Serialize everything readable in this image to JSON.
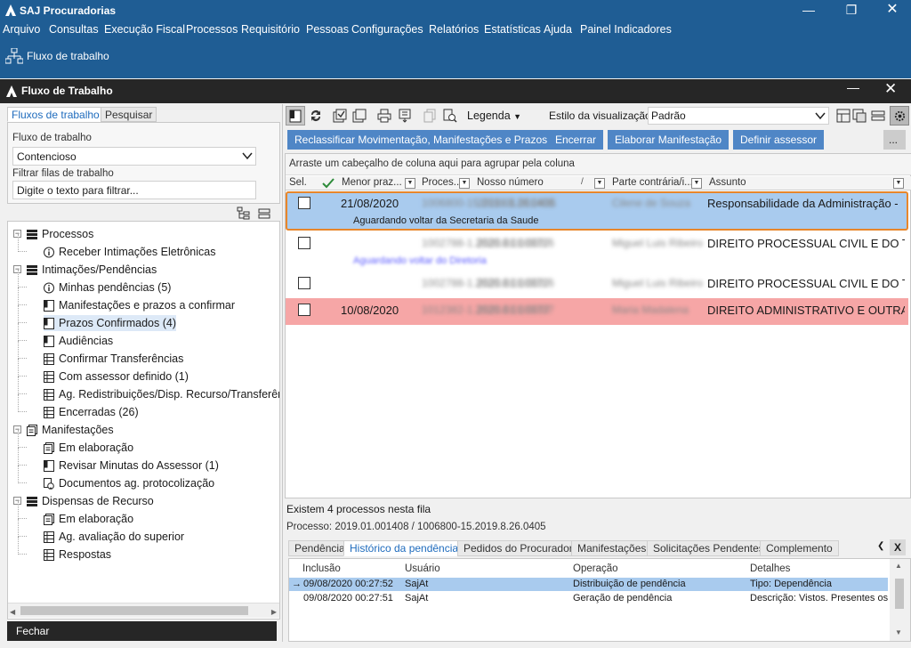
{
  "app": {
    "title": "SAJ Procuradorias"
  },
  "menu": [
    "Arquivo",
    "Consultas",
    "Execução Fiscal",
    "Processos",
    "Requisitório",
    "Pessoas",
    "Configurações",
    "Relatórios",
    "Estatísticas",
    "Ajuda",
    "Painel Indicadores"
  ],
  "nav": {
    "label": "Fluxo de trabalho"
  },
  "window": {
    "title": "Fluxo de Trabalho"
  },
  "left": {
    "tabs": [
      "Fluxos de trabalho",
      "Pesquisar"
    ],
    "flow_label": "Fluxo de trabalho",
    "flow_value": "Contencioso",
    "filter_label": "Filtrar filas de trabalho",
    "filter_placeholder": "Digite o texto para filtrar...",
    "close_label": "Fechar"
  },
  "tree": [
    {
      "label": "Processos",
      "level": 0,
      "icon": "list-icon",
      "expanded": true
    },
    {
      "label": "Receber Intimações Eletrônicas",
      "level": 1,
      "icon": "info-icon"
    },
    {
      "label": "Intimações/Pendências",
      "level": 0,
      "icon": "list-icon",
      "expanded": true
    },
    {
      "label": "Minhas pendências (5)",
      "level": 1,
      "icon": "info-icon"
    },
    {
      "label": "Manifestações e prazos a confirmar",
      "level": 1,
      "icon": "bookmark-icon"
    },
    {
      "label": "Prazos Confirmados (4)",
      "level": 1,
      "icon": "bookmark-icon",
      "selected": true
    },
    {
      "label": "Audiências",
      "level": 1,
      "icon": "bookmark-icon"
    },
    {
      "label": "Confirmar Transferências",
      "level": 1,
      "icon": "grid-icon"
    },
    {
      "label": "Com assessor definido (1)",
      "level": 1,
      "icon": "grid-icon"
    },
    {
      "label": "Ag. Redistribuições/Disp. Recurso/Transferênc",
      "level": 1,
      "icon": "grid-icon"
    },
    {
      "label": "Encerradas (26)",
      "level": 1,
      "icon": "grid-icon"
    },
    {
      "label": "Manifestações",
      "level": 0,
      "icon": "document-icon",
      "expanded": true
    },
    {
      "label": "Em elaboração",
      "level": 1,
      "icon": "document-icon"
    },
    {
      "label": "Revisar Minutas do Assessor (1)",
      "level": 1,
      "icon": "bookmark-icon"
    },
    {
      "label": "Documentos ag. protocolização",
      "level": 1,
      "icon": "seal-icon"
    },
    {
      "label": "Dispensas de Recurso",
      "level": 0,
      "icon": "list-icon",
      "expanded": true
    },
    {
      "label": "Em elaboração",
      "level": 1,
      "icon": "document-icon"
    },
    {
      "label": "Ag. avaliação do superior",
      "level": 1,
      "icon": "grid-icon"
    },
    {
      "label": "Respostas",
      "level": 1,
      "icon": "grid-icon"
    }
  ],
  "toolbar": {
    "legend_label": "Legenda",
    "style_label": "Estilo da visualização",
    "style_value": "Padrão"
  },
  "actions": [
    "Reclassificar Movimentação, Manifestações e Prazos",
    "Encerrar",
    "Elaborar Manifestação",
    "Definir assessor",
    "..."
  ],
  "grid": {
    "group_hint": "Arraste um cabeçalho de coluna aqui para agrupar pela coluna",
    "columns": [
      "Sel.",
      "Menor praz...",
      "Proces...",
      "Nosso número",
      "Parte contrária/i...",
      "Assunto"
    ],
    "rows": [
      {
        "date": "21/08/2020",
        "process": "1006800-15.2019.8.26.0405",
        "ours": "2019.01.001408",
        "party": "Cilene de Souza",
        "subject": "Responsabilidade da Administração -",
        "note": "Aguardando voltar da Secretaria da Saude",
        "style": "selected"
      },
      {
        "date": "",
        "process": "1002788-1.2020.8.01.0037",
        "ours": "2020.01.003716",
        "party": "Miguel Luis Ribeiro",
        "subject": "DIREITO PROCESSUAL CIVIL E DO TRA",
        "note": "Aguardando voltar do Diretoria",
        "style": "normal"
      },
      {
        "date": "",
        "process": "1002788-1.2020.8.01.0037",
        "ours": "2020.01.003716",
        "party": "Miguel Luis Ribeiro",
        "subject": "DIREITO PROCESSUAL CIVIL E DO TRA",
        "note": "",
        "style": "normal"
      },
      {
        "date": "10/08/2020",
        "process": "1012382-1.2020.8.01.0037",
        "ours": "2020.01.003737",
        "party": "Maria Madalena",
        "subject": "DIREITO ADMINISTRATIVO E OUTRAS",
        "note": "",
        "style": "alert"
      }
    ]
  },
  "status": {
    "count_text": "Existem 4 processos nesta fila",
    "process_text": "Processo: 2019.01.001408 / 1006800-15.2019.8.26.0405"
  },
  "bottom_tabs": [
    "Pendência",
    "Histórico da pendência",
    "Pedidos do Procurador",
    "Manifestações",
    "Solicitações Pendentes",
    "Complemento"
  ],
  "history": {
    "columns": [
      "Inclusão",
      "Usuário",
      "Operação",
      "Detalhes"
    ],
    "rows": [
      {
        "date": "09/08/2020 00:27:52",
        "user": "SajAt",
        "op": "Distribuição de pendência",
        "details": "Tipo: Dependência",
        "current": true
      },
      {
        "date": "09/08/2020 00:27:51",
        "user": "SajAt",
        "op": "Geração de pendência",
        "details": "Descrição: Vistos. Presentes os",
        "current": false
      }
    ]
  },
  "colors": {
    "brand": "#1f5d94",
    "button": "#4f86c6",
    "selected_row": "#a9cbee",
    "alert_row": "#f6a6a6",
    "highlight_border": "#e8862a"
  }
}
